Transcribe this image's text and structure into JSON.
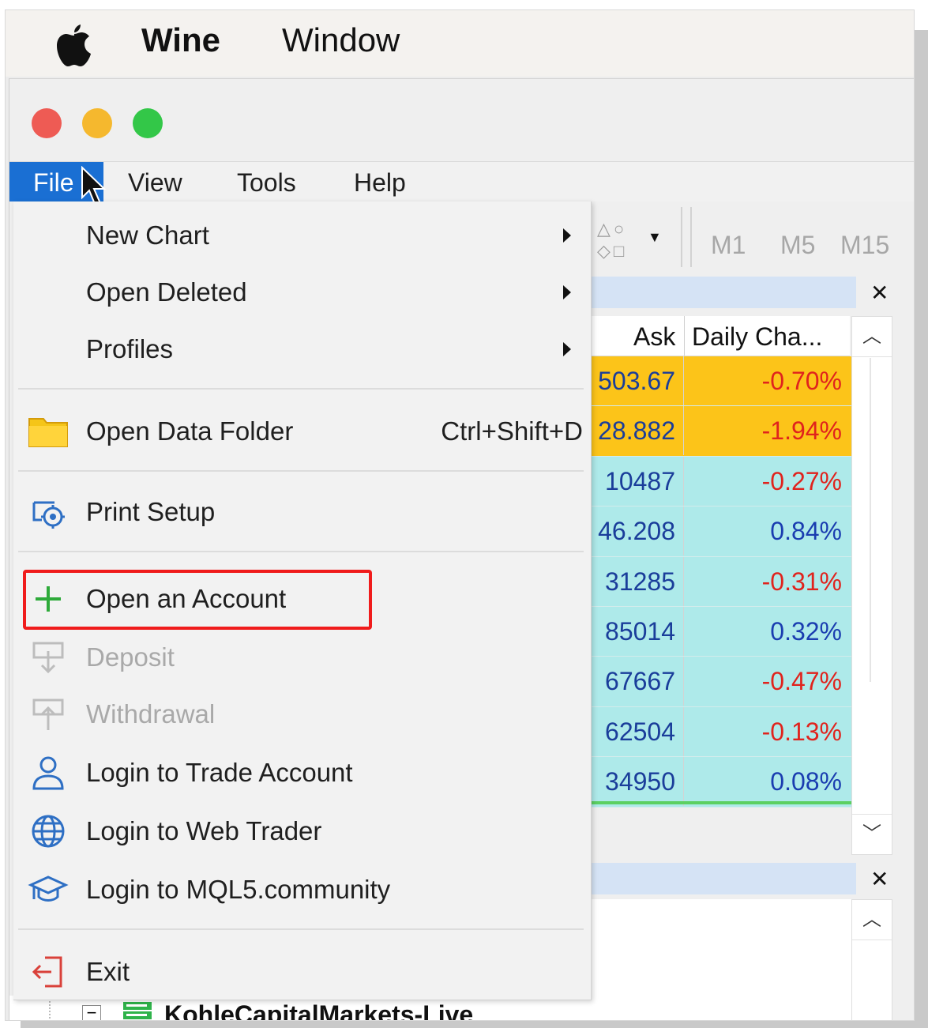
{
  "mac_menubar": {
    "app_name": "Wine",
    "window_menu": "Window"
  },
  "app_menu": {
    "file": "File",
    "view": "View",
    "tools": "Tools",
    "help": "Help"
  },
  "toolbar": {
    "timeframes": [
      "M1",
      "M5",
      "M15"
    ]
  },
  "file_menu": {
    "new_chart": "New Chart",
    "open_deleted": "Open Deleted",
    "profiles": "Profiles",
    "open_data_folder": "Open Data Folder",
    "open_data_folder_shortcut": "Ctrl+Shift+D",
    "print_setup": "Print Setup",
    "open_account": "Open an Account",
    "deposit": "Deposit",
    "withdrawal": "Withdrawal",
    "login_trade": "Login to Trade Account",
    "login_web": "Login to Web Trader",
    "login_mql5": "Login to MQL5.community",
    "exit": "Exit"
  },
  "market_watch": {
    "columns": {
      "ask": "Ask",
      "daily_change": "Daily Cha..."
    },
    "rows": [
      {
        "ask": "503.67",
        "change": "-0.70%",
        "bg": "#fcc419",
        "change_color": "#e0231d"
      },
      {
        "ask": "28.882",
        "change": "-1.94%",
        "bg": "#fcc419",
        "change_color": "#e0231d"
      },
      {
        "ask": "10487",
        "change": "-0.27%",
        "bg": "#aeeaea",
        "change_color": "#e0231d"
      },
      {
        "ask": "46.208",
        "change": "0.84%",
        "bg": "#aeeaea",
        "change_color": "#1a3db0"
      },
      {
        "ask": "31285",
        "change": "-0.31%",
        "bg": "#aeeaea",
        "change_color": "#e0231d"
      },
      {
        "ask": "85014",
        "change": "0.32%",
        "bg": "#aeeaea",
        "change_color": "#1a3db0"
      },
      {
        "ask": "67667",
        "change": "-0.47%",
        "bg": "#aeeaea",
        "change_color": "#e0231d"
      },
      {
        "ask": "62504",
        "change": "-0.13%",
        "bg": "#aeeaea",
        "change_color": "#e0231d"
      },
      {
        "ask": "34950",
        "change": "0.08%",
        "bg": "#aeeaea",
        "change_color": "#1a3db0"
      }
    ]
  },
  "navigator": {
    "server": "KohleCapitalMarkets-Live"
  },
  "colors": {
    "menu_selected": "#1a6fd3",
    "highlight_box": "#f01c1c"
  }
}
